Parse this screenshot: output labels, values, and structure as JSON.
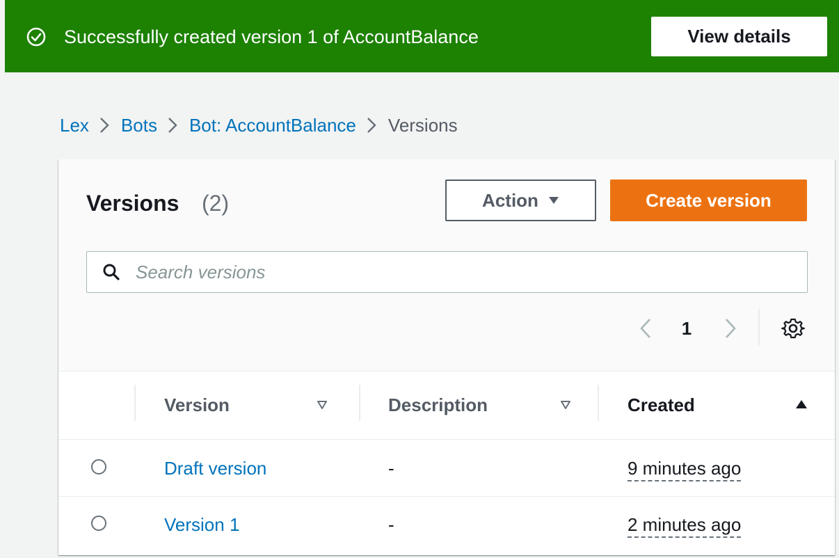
{
  "flash": {
    "message": "Successfully created version 1 of AccountBalance",
    "action_label": "View details",
    "icon": "check-circle-icon",
    "color": "#1d8102"
  },
  "breadcrumb": {
    "items": [
      {
        "label": "Lex",
        "link": true
      },
      {
        "label": "Bots",
        "link": true
      },
      {
        "label": "Bot: AccountBalance",
        "link": true
      },
      {
        "label": "Versions",
        "link": false
      }
    ]
  },
  "panel": {
    "title": "Versions",
    "count": "(2)",
    "action_label": "Action",
    "create_label": "Create version",
    "accent": "#ec7211"
  },
  "search": {
    "placeholder": "Search versions",
    "value": ""
  },
  "pagination": {
    "current_page": "1"
  },
  "table": {
    "columns": [
      {
        "label": "Version",
        "sort": "unsorted"
      },
      {
        "label": "Description",
        "sort": "unsorted"
      },
      {
        "label": "Created",
        "sort": "ascending"
      }
    ],
    "rows": [
      {
        "version": "Draft version",
        "description": "-",
        "created": "9 minutes ago",
        "selected": false
      },
      {
        "version": "Version 1",
        "description": "-",
        "created": "2 minutes ago",
        "selected": false
      }
    ]
  }
}
